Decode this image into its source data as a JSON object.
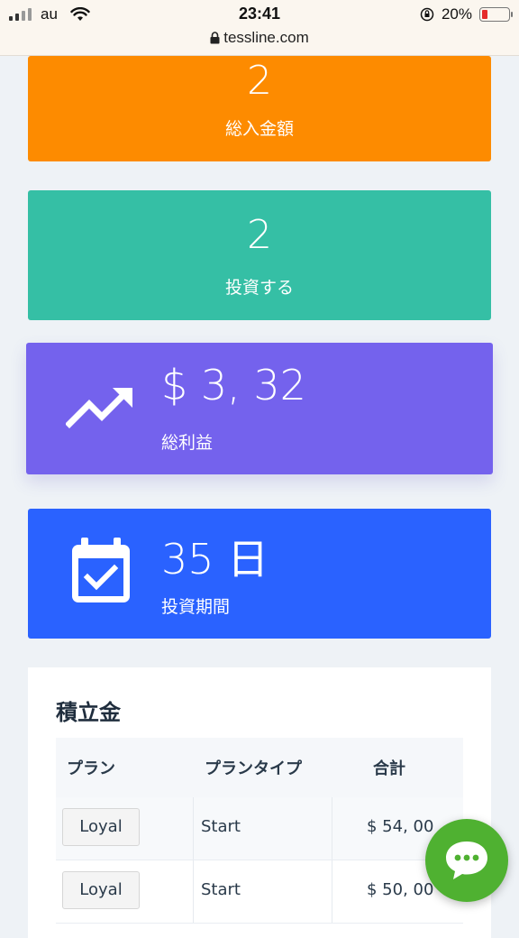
{
  "status_bar": {
    "carrier": "au",
    "time": "23:41",
    "battery": "20%",
    "battery_level": 0.2,
    "url": "tessline.com"
  },
  "stats": {
    "total_deposit": {
      "value": "2",
      "label": "総入金額"
    },
    "invest": {
      "value": "2",
      "label": "投資する"
    },
    "total_profit": {
      "value": "$ 3, 32",
      "label": "総利益",
      "icon": "trending-up-icon"
    },
    "period": {
      "value": "35 日",
      "label": "投資期間",
      "icon": "calendar-check-icon"
    }
  },
  "savings": {
    "title": "積立金",
    "columns": [
      "プラン",
      "プランタイプ",
      "合計"
    ],
    "rows": [
      {
        "plan": "Loyal",
        "type": "Start",
        "total": "$ 54, 00"
      },
      {
        "plan": "Loyal",
        "type": "Start",
        "total": "$ 50, 00"
      }
    ]
  },
  "chat_button": {
    "icon": "chat-bubble-icon"
  },
  "colors": {
    "orange": "#fd8b00",
    "teal": "#35bfa5",
    "purple": "#7462ed",
    "blue": "#2a62ff",
    "chat_green": "#4fb131"
  }
}
